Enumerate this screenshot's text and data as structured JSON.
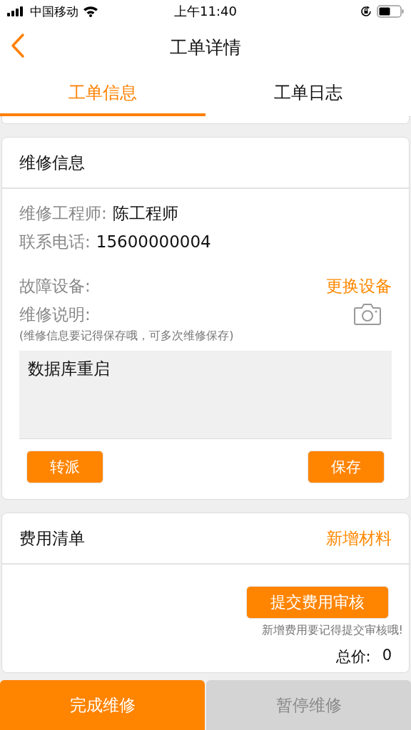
{
  "status_bar": {
    "carrier": "中国移动",
    "time": "上午11:40"
  },
  "nav": {
    "title": "工单详情"
  },
  "tabs": [
    {
      "label": "工单信息",
      "selected": true
    },
    {
      "label": "工单日志",
      "selected": false
    }
  ],
  "repair_card": {
    "title": "维修信息",
    "engineer_label": "维修工程师:",
    "engineer": "陈工程师",
    "phone_label": "联系电话:",
    "phone": "15600000004",
    "device_label": "故障设备:",
    "replace_link": "更换设备",
    "desc_label": "维修说明:",
    "desc_hint": "(维修信息要记得保存哦，可多次维修保存)",
    "desc_value": "数据库重启",
    "buttons": [
      "转派",
      "保存"
    ]
  },
  "cost_card": {
    "title": "费用清单",
    "add_link": "新增材料",
    "submit_button": "提交费用审核",
    "hint": "新增费用要记得提交审核哦!",
    "total_label": "总价:",
    "total": "0"
  },
  "bottom_buttons": [
    {
      "label": "完成维修",
      "disabled": false
    },
    {
      "label": "暂停维修",
      "disabled": true
    }
  ]
}
